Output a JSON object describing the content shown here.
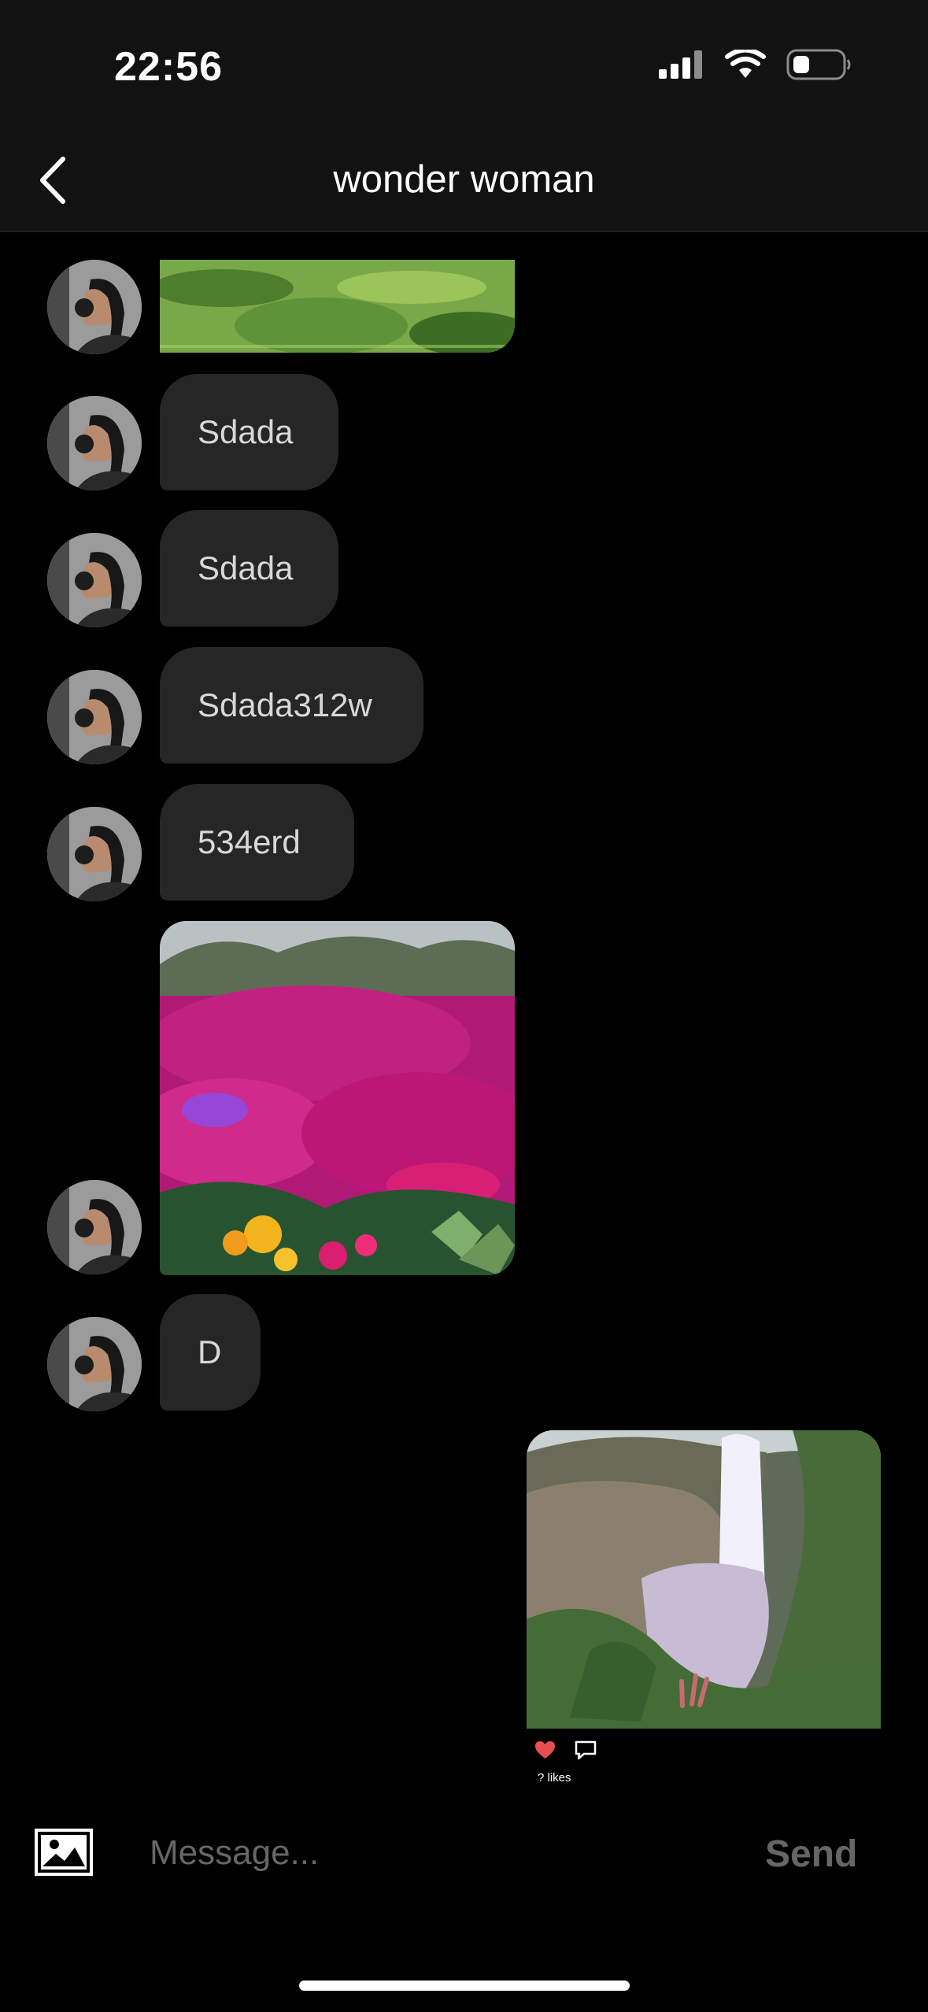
{
  "status": {
    "time": "22:56",
    "icons": [
      "signal-icon",
      "wifi-icon",
      "battery-icon"
    ]
  },
  "header": {
    "title": "wonder woman",
    "back_icon": "chevron-left-icon"
  },
  "messages": {
    "texts": [
      "Sdada",
      "Sdada",
      "Sdada312w",
      "534erd",
      "D"
    ],
    "media": [
      "green-leaves-photo",
      "pink-flowers-photo",
      "waterfall-photo"
    ]
  },
  "post": {
    "likes": "? likes",
    "icons": [
      "heart-icon",
      "comment-icon"
    ]
  },
  "composer": {
    "placeholder": "Message...",
    "send_label": "Send",
    "gallery_icon": "image-icon"
  },
  "colors": {
    "background": "#000000",
    "header": "#121212",
    "bubble": "#262626",
    "send": "#666666",
    "heart": "#e94d4d"
  }
}
